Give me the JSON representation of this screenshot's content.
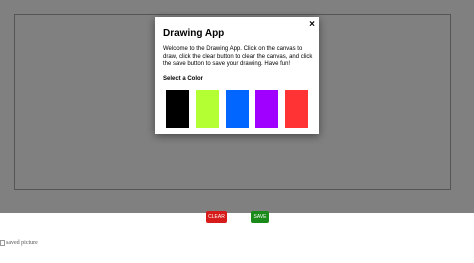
{
  "modal": {
    "close_label": "×",
    "title": "Drawing App",
    "description": "Welcome to the Drawing App. Click on the canvas to draw, click the clear button to clear the canvas, and click the save button to save your drawing. Have fun!",
    "select_color_label": "Select a Color",
    "colors": [
      "#000000",
      "#b3ff33",
      "#0066ff",
      "#a000ff",
      "#ff3333"
    ]
  },
  "buttons": {
    "clear_label": "CLEAR",
    "save_label": "SAVE"
  },
  "saved_image": {
    "alt_text": "saved picture"
  }
}
